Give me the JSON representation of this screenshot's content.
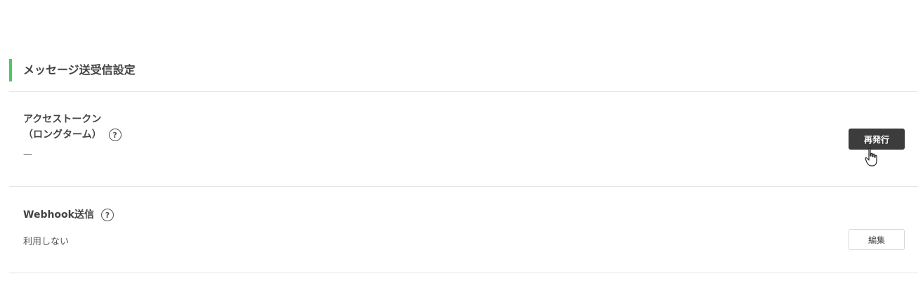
{
  "section": {
    "title": "メッセージ送受信設定"
  },
  "access_token": {
    "label_line1": "アクセストークン",
    "label_line2": "（ロングターム）",
    "help_glyph": "?",
    "value": "—",
    "button_label": "再発行"
  },
  "webhook": {
    "label": "Webhook送信",
    "help_glyph": "?",
    "value": "利用しない",
    "button_label": "編集"
  },
  "colors": {
    "accent": "#4cc764",
    "primary_button": "#3c3c3c",
    "divider": "#e5e5e5"
  },
  "icons": {
    "help": "question-circle-icon",
    "cursor": "hand-pointer-icon"
  }
}
